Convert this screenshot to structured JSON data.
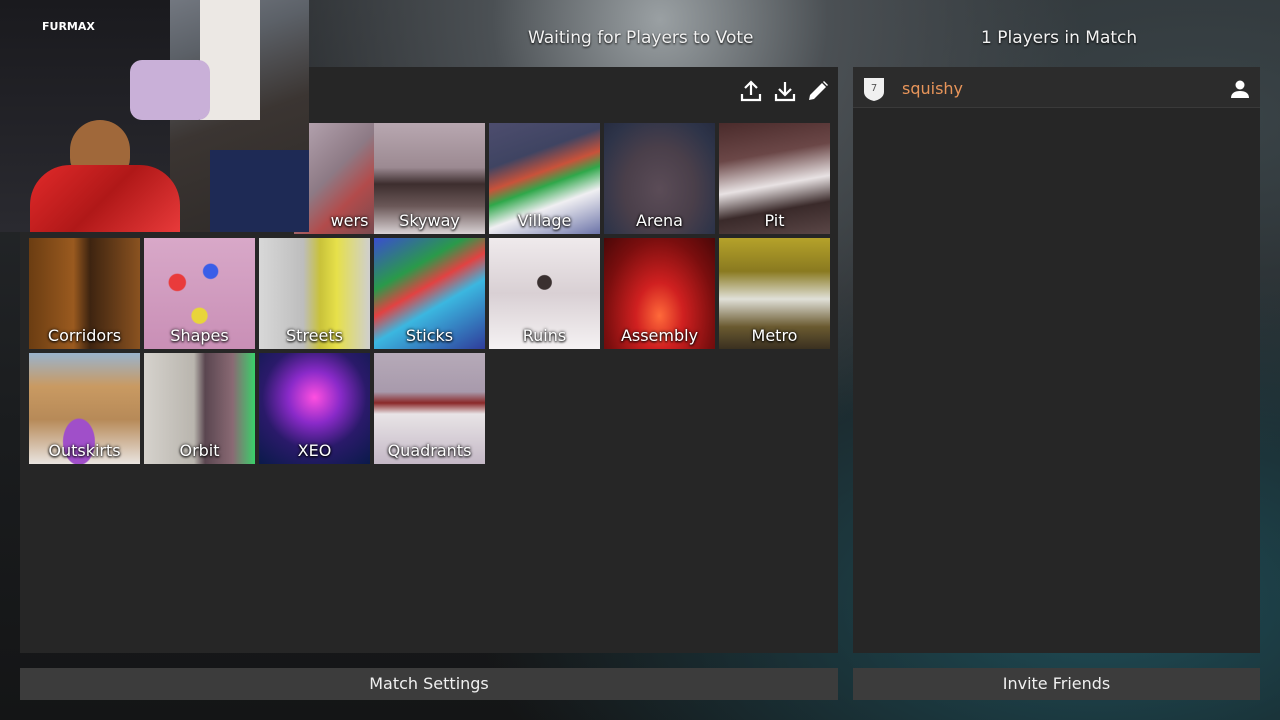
{
  "header": {
    "vote_status": "Waiting for Players to Vote",
    "player_count": "1 Players in Match"
  },
  "toolbar": {
    "icons": [
      "upload-icon",
      "download-icon",
      "edit-icon"
    ]
  },
  "maps": {
    "row1": [
      "wers",
      "Skyway",
      "Village",
      "Arena",
      "Pit"
    ],
    "row2": [
      "Corridors",
      "Shapes",
      "Streets",
      "Sticks",
      "Ruins",
      "Assembly",
      "Metro"
    ],
    "row3": [
      "Outskirts",
      "Orbit",
      "XEO",
      "Quadrants"
    ]
  },
  "players": [
    {
      "rank": "7",
      "name": "squishy",
      "name_color": "#e8955a"
    }
  ],
  "webcam": {
    "chair_brand": "FURMAX"
  },
  "buttons": {
    "match_settings": "Match Settings",
    "invite_friends": "Invite Friends"
  },
  "colors": {
    "panel": "#262626",
    "button": "#3c3c3c",
    "player_name": "#e8955a"
  }
}
